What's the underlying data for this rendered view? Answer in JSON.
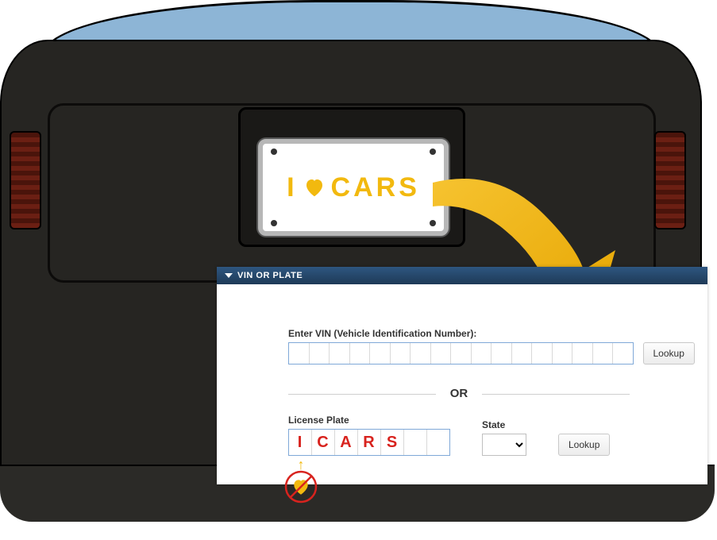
{
  "plate": {
    "prefix": "I",
    "mid_icon": "heart-icon",
    "suffix": "CARS"
  },
  "panel": {
    "header": "VIN OR PLATE",
    "vin": {
      "label": "Enter VIN (Vehicle Identification Number):",
      "value": "",
      "lookup_label": "Lookup"
    },
    "or_label": "OR",
    "license": {
      "label": "License Plate",
      "value": "ICARS",
      "lookup_label": "Lookup"
    },
    "state": {
      "label": "State",
      "value": ""
    },
    "annotation": {
      "icon": "heart-icon",
      "meaning": "omit-symbol"
    }
  },
  "colors": {
    "accent": "#f2b90f",
    "panel_header_bg": "#264b70",
    "plate_text": "#d8231e"
  }
}
